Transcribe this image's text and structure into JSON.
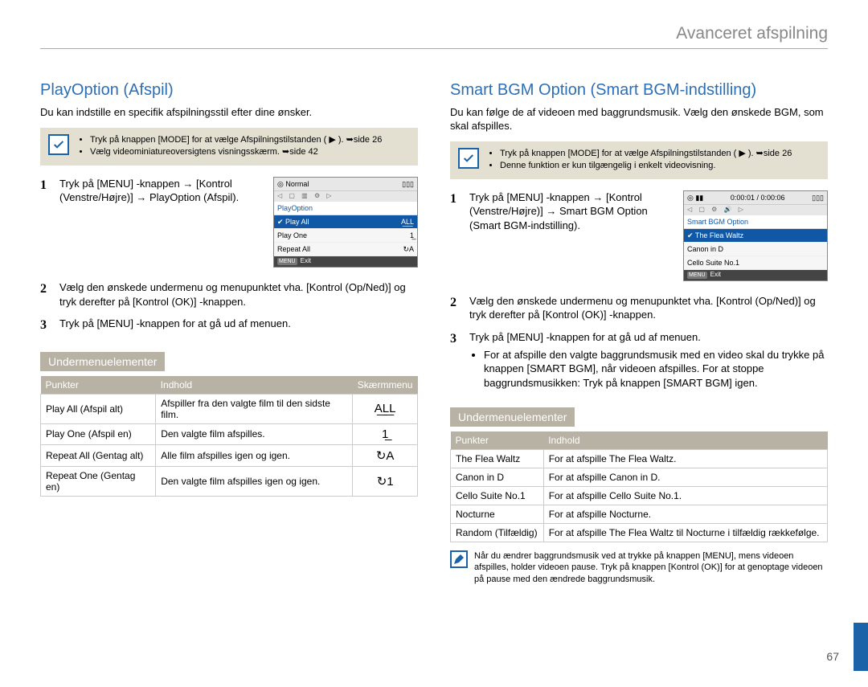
{
  "chapter": "Avanceret afspilning",
  "page_number": "67",
  "left": {
    "title": "PlayOption (Afspil)",
    "intro": "Du kan indstille en specifik afspilningsstil efter dine ønsker.",
    "note": [
      "Tryk på knappen [MODE] for at vælge Afspilningstilstanden ( ▶ ). ➥side 26",
      "Vælg videominiatureoversigtens visningsskærm. ➥side 42"
    ],
    "steps": [
      "Tryk på [MENU] -knappen → [Kontrol (Venstre/Højre)] → PlayOption (Afspil).",
      "Vælg den ønskede undermenu og menupunktet vha. [Kontrol (Op/Ned)] og tryk derefter på [Kontrol (OK)] -knappen.",
      "Tryk på [MENU] -knappen for at gå ud af menuen."
    ],
    "sub_header": "Undermenuelementer",
    "table_headers": {
      "c1": "Punkter",
      "c2": "Indhold",
      "c3": "Skærmmenu"
    },
    "table": [
      {
        "p": "Play All (Afspil alt)",
        "d": "Afspiller fra den valgte film til den sidste film.",
        "icon": "A͟L͟L"
      },
      {
        "p": "Play One (Afspil en)",
        "d": "Den valgte film afspilles.",
        "icon": "1̲"
      },
      {
        "p": "Repeat All (Gentag alt)",
        "d": "Alle film afspilles igen og igen.",
        "icon": "↻A"
      },
      {
        "p": "Repeat One (Gentag en)",
        "d": "Den valgte film afspilles igen og igen.",
        "icon": "↻1"
      }
    ],
    "lcd": {
      "header": "Normal",
      "menu_title": "PlayOption",
      "rows": [
        {
          "label": "Play All",
          "sel": true,
          "icon": "A͟L͟L"
        },
        {
          "label": "Play One",
          "sel": false,
          "icon": "1̲"
        },
        {
          "label": "Repeat All",
          "sel": false,
          "icon": "↻A"
        }
      ],
      "footer_label": "MENU",
      "footer_text": "Exit"
    }
  },
  "right": {
    "title": "Smart BGM Option (Smart BGM-indstilling)",
    "intro": "Du kan følge de af videoen med baggrundsmusik. Vælg den ønskede BGM, som skal afspilles.",
    "note": [
      "Tryk på knappen [MODE] for at vælge Afspilningstilstanden ( ▶ ). ➥side 26",
      "Denne funktion er kun tilgængelig i enkelt videovisning."
    ],
    "steps": [
      "Tryk på [MENU] -knappen → [Kontrol (Venstre/Højre)] → Smart BGM Option (Smart BGM-indstilling).",
      "Vælg den ønskede undermenu og menupunktet vha. [Kontrol (Op/Ned)] og tryk derefter på [Kontrol (OK)] -knappen.",
      "Tryk på [MENU] -knappen for at gå ud af menuen."
    ],
    "step3_bullet": "For at afspille den valgte baggrundsmusik med en video skal du trykke på knappen [SMART BGM], når videoen afspilles. For at stoppe baggrundsmusikken: Tryk på knappen [SMART BGM] igen.",
    "sub_header": "Undermenuelementer",
    "table_headers": {
      "c1": "Punkter",
      "c2": "Indhold"
    },
    "table": [
      {
        "p": "The Flea Waltz",
        "d": "For at afspille The Flea Waltz."
      },
      {
        "p": "Canon in D",
        "d": "For at afspille Canon in D."
      },
      {
        "p": "Cello Suite No.1",
        "d": "For at afspille Cello Suite No.1."
      },
      {
        "p": "Nocturne",
        "d": "For at afspille Nocturne."
      },
      {
        "p": "Random (Tilfældig)",
        "d": "For at afspille The Flea Waltz til Nocturne i tilfældig rækkefølge."
      }
    ],
    "lcd": {
      "time": "0:00:01 / 0:00:06",
      "menu_title": "Smart BGM Option",
      "rows": [
        {
          "label": "The Flea Waltz",
          "sel": true
        },
        {
          "label": "Canon in D",
          "sel": false
        },
        {
          "label": "Cello Suite No.1",
          "sel": false
        }
      ],
      "footer_label": "MENU",
      "footer_text": "Exit"
    },
    "footnote": "Når du ændrer baggrundsmusik ved at trykke på knappen [MENU], mens videoen afspilles, holder videoen pause. Tryk på knappen [Kontrol (OK)] for at genoptage videoen på pause med den ændrede baggrundsmusik."
  }
}
